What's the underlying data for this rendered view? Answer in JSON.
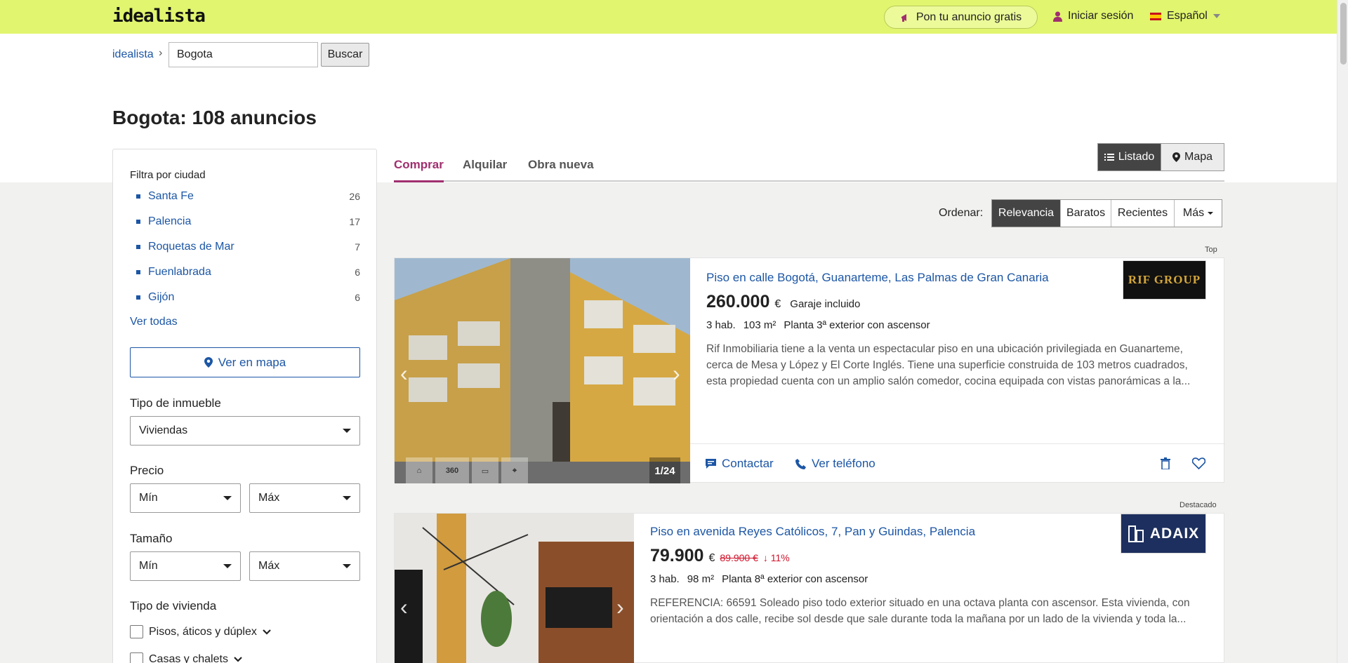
{
  "header": {
    "logo": "idealista",
    "anuncio_label": "Pon tu anuncio gratis",
    "login_label": "Iniciar sesión",
    "language": "Español"
  },
  "breadcrumb": {
    "home": "idealista",
    "separator": "›"
  },
  "search": {
    "value": "Bogota",
    "button": "Buscar"
  },
  "page_title": "Bogota: 108 anuncios",
  "tabs": [
    {
      "label": "Comprar",
      "active": true
    },
    {
      "label": "Alquilar",
      "active": false
    },
    {
      "label": "Obra nueva",
      "active": false
    }
  ],
  "view": {
    "list_label": "Listado",
    "map_label": "Mapa"
  },
  "sidebar": {
    "filter_city_title": "Filtra por ciudad",
    "cities": [
      {
        "name": "Santa Fe",
        "count": "26"
      },
      {
        "name": "Palencia",
        "count": "17"
      },
      {
        "name": "Roquetas de Mar",
        "count": "7"
      },
      {
        "name": "Fuenlabrada",
        "count": "6"
      },
      {
        "name": "Gijón",
        "count": "6"
      }
    ],
    "see_all": "Ver todas",
    "see_map": "Ver en mapa",
    "property_type_label": "Tipo de inmueble",
    "property_type_value": "Viviendas",
    "price_label": "Precio",
    "price_min": "Mín",
    "price_max": "Máx",
    "size_label": "Tamaño",
    "size_min": "Mín",
    "size_max": "Máx",
    "housing_type_label": "Tipo de vivienda",
    "housing_options": [
      "Pisos, áticos y dúplex",
      "Casas y chalets"
    ]
  },
  "sort": {
    "label": "Ordenar:",
    "options": [
      "Relevancia",
      "Baratos",
      "Recientes",
      "Más"
    ],
    "active": "Relevancia"
  },
  "listings": [
    {
      "tag": "Top",
      "title": "Piso en calle Bogotá, Guanarteme, Las Palmas de Gran Canaria",
      "price": "260.000",
      "currency": "€",
      "price_extra": "Garaje incluido",
      "details": [
        "3 hab.",
        "103 m²",
        "Planta 3ª exterior con ascensor"
      ],
      "description": "Rif Inmobiliaria tiene a la venta un espectacular piso en una ubicación privilegiada en Guanarteme, cerca de Mesa y López y El Corte Inglés. Tiene una superficie construida de 103 metros cuadrados, esta propiedad cuenta con un amplio salón comedor, cocina equipada con vistas panorámicas a la...",
      "agency": "RIF GROUP",
      "photo_counter": "1/24",
      "photo_icons": [
        "plan-icon",
        "360",
        "video-icon",
        "location-icon"
      ],
      "contact_label": "Contactar",
      "phone_label": "Ver teléfono"
    },
    {
      "tag": "Destacado",
      "title": "Piso en avenida Reyes Católicos, 7, Pan y Guindas, Palencia",
      "price": "79.900",
      "currency": "€",
      "old_price": "89.900 €",
      "price_drop": "↓ 11%",
      "details": [
        "3 hab.",
        "98 m²",
        "Planta 8ª exterior con ascensor"
      ],
      "description": "REFERENCIA: 66591 Soleado piso todo exterior situado en una octava planta con ascensor. Esta vivienda, con orientación a dos calle, recibe sol desde que sale durante toda la mañana por un lado de la vivienda y toda la...",
      "agency": "ADAIX"
    }
  ],
  "colors": {
    "header_bg": "#e1f56e",
    "link": "#1c56a5",
    "accent_tab": "#a02f6e",
    "price_drop": "#d0142b"
  }
}
